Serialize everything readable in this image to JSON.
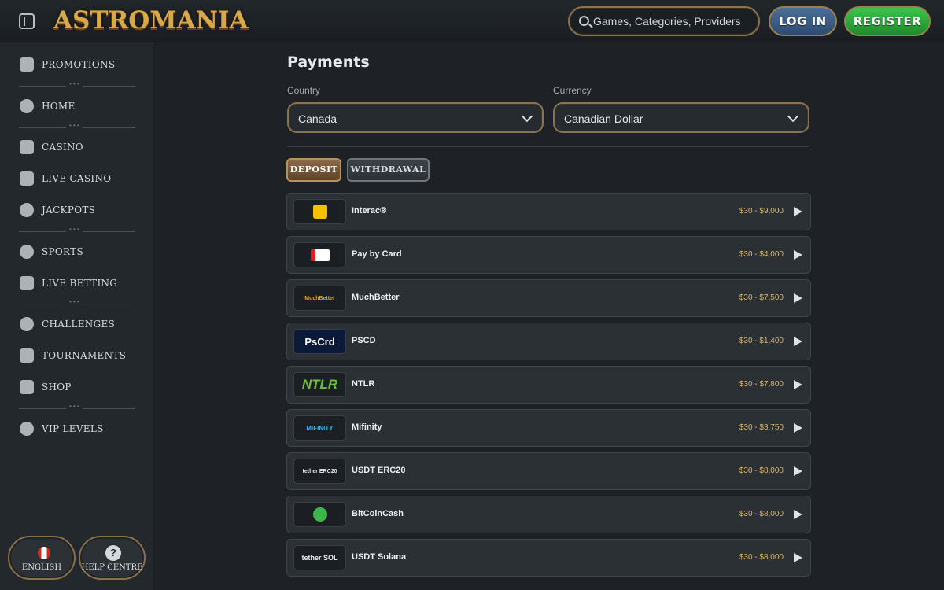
{
  "header": {
    "logo_text": "ASTROMANIA",
    "search_placeholder": "Games, Categories, Providers",
    "login_label": "LOG IN",
    "register_label": "REGISTER"
  },
  "sidebar": {
    "items": [
      {
        "label": "PROMOTIONS",
        "icon": "gift-icon"
      },
      {
        "label": "HOME",
        "icon": "home-icon"
      },
      {
        "label": "CASINO",
        "icon": "slot-machine-icon"
      },
      {
        "label": "LIVE CASINO",
        "icon": "card-icon"
      },
      {
        "label": "JACKPOTS",
        "icon": "clover-icon"
      },
      {
        "label": "SPORTS",
        "icon": "soccer-ball-icon"
      },
      {
        "label": "LIVE BETTING",
        "icon": "live-icon"
      },
      {
        "label": "CHALLENGES",
        "icon": "medal-icon"
      },
      {
        "label": "TOURNAMENTS",
        "icon": "podium-icon"
      },
      {
        "label": "SHOP",
        "icon": "chest-icon"
      },
      {
        "label": "VIP LEVELS",
        "icon": "vip-icon"
      }
    ],
    "language_label": "ENGLISH",
    "help_label": "HELP CENTRE"
  },
  "main": {
    "title": "Payments",
    "country_label": "Country",
    "country_value": "Canada",
    "currency_label": "Currency",
    "currency_value": "Canadian Dollar",
    "tabs": [
      {
        "label": "DEPOSIT",
        "active": true
      },
      {
        "label": "WITHDRAWAL",
        "active": false
      }
    ],
    "methods": [
      {
        "name": "Interac®",
        "range": "$30 - $9,000",
        "logo": "interac-logo"
      },
      {
        "name": "Pay by Card",
        "range": "$30 - $4,000",
        "logo": "card-logo"
      },
      {
        "name": "MuchBetter",
        "range": "$30 - $7,500",
        "logo_text": "MuchBetter"
      },
      {
        "name": "PSCD",
        "range": "$30 - $1,400",
        "logo_text": "PsCrd"
      },
      {
        "name": "NTLR",
        "range": "$30 - $7,800",
        "logo_text": "NTLR"
      },
      {
        "name": "Mifinity",
        "range": "$30 - $3,750",
        "logo_text": "MiFINITY"
      },
      {
        "name": "USDT ERC20",
        "range": "$30 - $8,000",
        "logo_text": "tether ERC20"
      },
      {
        "name": "BitCoinCash",
        "range": "$30 - $8,000",
        "logo": "bitcoin-cash-logo"
      },
      {
        "name": "USDT Solana",
        "range": "$30 - $8,000",
        "logo_text": "tether SOL"
      }
    ]
  }
}
